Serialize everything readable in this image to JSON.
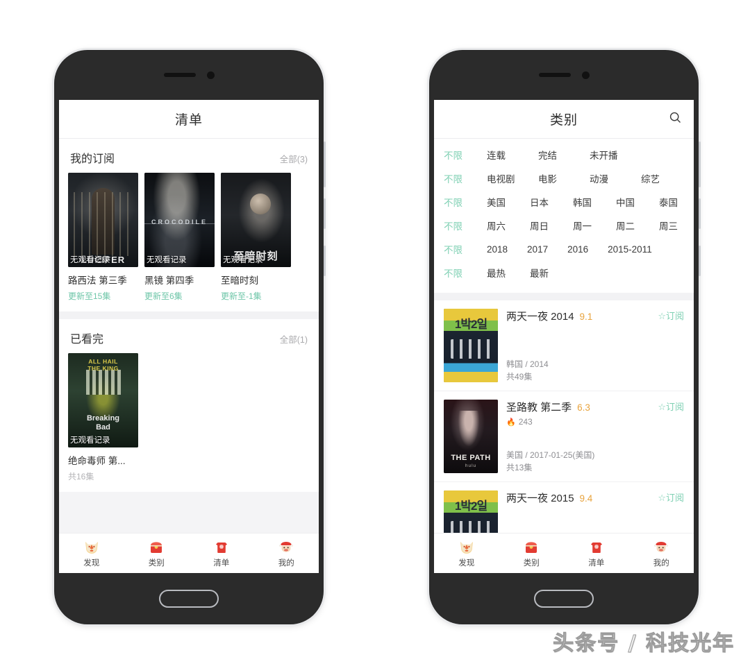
{
  "watermark": "头条号 / 科技光年",
  "phone_left": {
    "appbar": {
      "title": "清单"
    },
    "sections": [
      {
        "title": "我的订阅",
        "all_label": "全部(3)",
        "items": [
          {
            "title": "路西法 第三季",
            "sub": "更新至15集",
            "badge": "无观看记录",
            "poster_text": "LUCIFER",
            "art": "art-lucifer"
          },
          {
            "title": "黑镜 第四季",
            "sub": "更新至6集",
            "badge": "无观看记录",
            "poster_text": "CROCODILE",
            "art": "art-crocodile"
          },
          {
            "title": "至暗时刻",
            "sub": "更新至-1集",
            "badge": "无观看记录",
            "poster_text": "至暗时刻",
            "art": "art-darkest"
          }
        ]
      },
      {
        "title": "已看完",
        "all_label": "全部(1)",
        "items": [
          {
            "title": "绝命毒师 第...",
            "sub": "共16集",
            "badge": "无观看记录",
            "poster_text": "",
            "art": "art-bb",
            "overlay_top": "ALL HAIL\nTHE KING",
            "overlay_brand": "Breaking\nBad"
          }
        ]
      }
    ],
    "tabbar": [
      {
        "label": "发现",
        "icon": "fox-face-icon",
        "active": false
      },
      {
        "label": "类别",
        "icon": "red-packet-icon",
        "active": false
      },
      {
        "label": "清单",
        "icon": "red-envelope-fu-icon",
        "active": true
      },
      {
        "label": "我的",
        "icon": "santa-face-icon",
        "active": false
      }
    ]
  },
  "phone_right": {
    "appbar": {
      "title": "类别",
      "search_icon": "search-icon"
    },
    "filter_rows": [
      {
        "any_label": "不限",
        "options": [
          "连载",
          "完结",
          "未开播"
        ]
      },
      {
        "any_label": "不限",
        "options": [
          "电视剧",
          "电影",
          "动漫",
          "综艺"
        ]
      },
      {
        "any_label": "不限",
        "options": [
          "美国",
          "日本",
          "韩国",
          "中国",
          "泰国"
        ]
      },
      {
        "any_label": "不限",
        "options": [
          "周六",
          "周日",
          "周一",
          "周二",
          "周三"
        ]
      },
      {
        "any_label": "不限",
        "options": [
          "2018",
          "2017",
          "2016",
          "2015-2011"
        ]
      },
      {
        "any_label": "不限",
        "options": [
          "最热",
          "最新"
        ]
      }
    ],
    "list": [
      {
        "title": "两天一夜 2014",
        "score": "9.1",
        "hot": "",
        "meta1": "韩国 / 2014",
        "meta2": "共49集",
        "subscribe": "☆订阅",
        "art": "art-2days",
        "poster_text": "1박2일"
      },
      {
        "title": "圣路教 第二季",
        "score": "6.3",
        "hot": "243",
        "meta1": "美国 / 2017-01-25(美国)",
        "meta2": "共13集",
        "subscribe": "☆订阅",
        "art": "art-path",
        "poster_text": "THE PATH"
      },
      {
        "title": "两天一夜 2015",
        "score": "9.4",
        "hot": "",
        "meta1": "",
        "meta2": "",
        "subscribe": "☆订阅",
        "art": "art-2days",
        "poster_text": "1박2일"
      }
    ],
    "tabbar": [
      {
        "label": "发现",
        "icon": "fox-face-icon",
        "active": false
      },
      {
        "label": "类别",
        "icon": "red-packet-icon",
        "active": true
      },
      {
        "label": "清单",
        "icon": "red-envelope-fu-icon",
        "active": false
      },
      {
        "label": "我的",
        "icon": "santa-face-icon",
        "active": false
      }
    ]
  },
  "colors": {
    "accent_green": "#7fd0b3",
    "score_orange": "#e8a33d",
    "bg_gray": "#f2f2f4",
    "bezel": "#2b2b2b"
  }
}
